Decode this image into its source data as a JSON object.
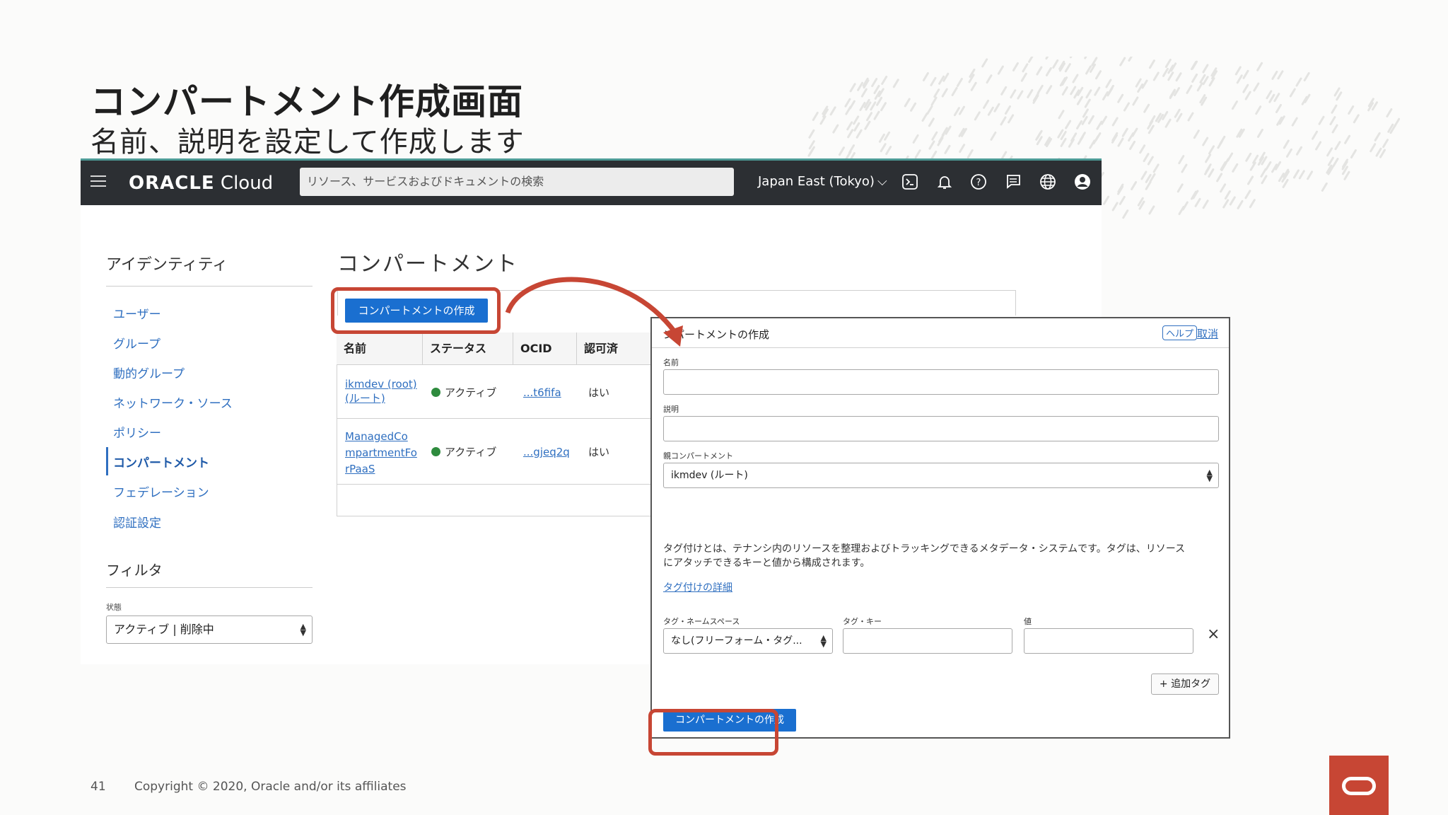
{
  "slide": {
    "title": "コンパートメント作成画面",
    "subtitle": "名前、説明を設定して作成します",
    "page_number": "41",
    "copyright": "Copyright © 2020, Oracle and/or its affiliates"
  },
  "console": {
    "logo": "ORACLE",
    "logo_suffix": "Cloud",
    "search_placeholder": "リソース、サービスおよびドキュメントの検索",
    "region": "Japan East (Tokyo)",
    "icons": [
      "menu-icon",
      "cloud-shell-icon",
      "bell-icon",
      "help-icon",
      "chat-icon",
      "globe-icon",
      "profile-icon"
    ]
  },
  "sidebar": {
    "heading": "アイデンティティ",
    "items": [
      {
        "label": "ユーザー"
      },
      {
        "label": "グループ"
      },
      {
        "label": "動的グループ"
      },
      {
        "label": "ネットワーク・ソース"
      },
      {
        "label": "ポリシー"
      },
      {
        "label": "コンパートメント",
        "active": true
      },
      {
        "label": "フェデレーション"
      },
      {
        "label": "認証設定"
      }
    ],
    "filter_heading": "フィルタ",
    "state_label": "状態",
    "state_value": "アクティブ | 削除中"
  },
  "main": {
    "title": "コンパートメント",
    "create_button": "コンパートメントの作成",
    "table": {
      "headers": [
        "名前",
        "ステータス",
        "OCID",
        "認可済"
      ],
      "rows": [
        {
          "name_line1": "ikmdev (root)",
          "name_line2": "(ルート)",
          "status": "アクティブ",
          "ocid": "...t6fifa",
          "authorized": "はい"
        },
        {
          "name_line1": "ManagedCo",
          "name_line2": "mpartmentFo",
          "name_line3": "rPaaS",
          "status": "アクティブ",
          "ocid": "...gjeq2q",
          "authorized": "はい"
        }
      ]
    }
  },
  "dialog": {
    "title": "ンパートメントの作成",
    "help": "ヘルプ",
    "cancel": "取消",
    "name_label": "名前",
    "desc_label": "説明",
    "parent_label": "親コンパートメント",
    "parent_value": "ikmdev (ルート)",
    "tag_text_1": "タグ付けとは、テナンシ内のリソースを整理およびトラッキングできるメタデータ・システムです。タグは、リソース",
    "tag_text_2": "にアタッチできるキーと値から構成されます。",
    "tag_link": "タグ付けの詳細",
    "tag_ns_label": "タグ・ネームスペース",
    "tag_key_label": "タグ・キー",
    "tag_value_label": "値",
    "tag_ns_value": "なし(フリーフォーム・タグ...",
    "remove_icon": "×",
    "add_tag": "+ 追加タグ",
    "submit": "コンパートメントの作成"
  },
  "colors": {
    "accent_red": "#c74634",
    "button_blue": "#1a6fd0",
    "link_blue": "#2f6fc0",
    "topbar": "#2c2f33",
    "status_green": "#2e8b3e"
  }
}
